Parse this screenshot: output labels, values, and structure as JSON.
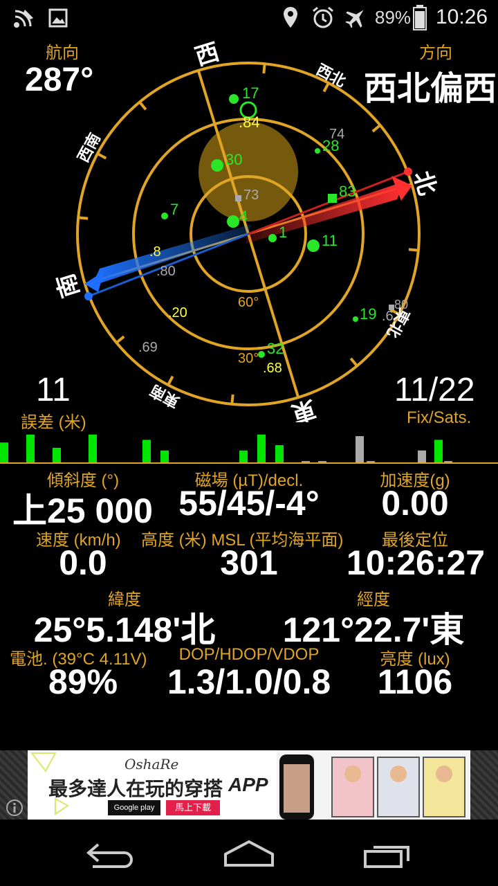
{
  "status": {
    "battery": "89%",
    "time": "10:26",
    "icons": [
      "signal-wifi-icon",
      "image-icon",
      "location-icon",
      "alarm-icon",
      "airplane-icon",
      "battery-icon"
    ]
  },
  "compass": {
    "heading_label": "航向",
    "heading_value": "287°",
    "direction_label": "方向",
    "direction_value": "西北偏西",
    "directions": {
      "west": "西",
      "northwest": "西北",
      "north": "北",
      "northeast": "東北",
      "east": "東",
      "southeast": "東南",
      "south": "南",
      "southwest": "西南"
    },
    "ring_60": "60°",
    "ring_30": "30°",
    "satellites": [
      {
        "id": "17",
        "color": "#29e629"
      },
      {
        "id": "30",
        "color": "#29e629"
      },
      {
        "id": "28",
        "color": "#29e629"
      },
      {
        "id": "7",
        "color": "#29e629"
      },
      {
        "id": "4",
        "color": "#29e629"
      },
      {
        "id": "1",
        "color": "#29e629"
      },
      {
        "id": "11",
        "color": "#29e629"
      },
      {
        "id": "83",
        "color": "#29e629"
      },
      {
        "id": "19",
        "color": "#29e629"
      },
      {
        "id": "32",
        "color": "#29e629"
      }
    ],
    "labels": {
      "l84": ".84",
      "l74": "74",
      "l73": "73",
      "l8": ".8",
      "l80": ".80",
      "l20": ".20",
      "l69": ".69",
      "l68": ".68",
      "l6": ".6",
      "l80b": "80"
    }
  },
  "accuracy": {
    "value": "11",
    "label": "誤差 (米)"
  },
  "fix": {
    "value": "11/22",
    "label": "Fix/Sats."
  },
  "signal_bars": [
    {
      "h": 0.4,
      "c": "#00e600"
    },
    {
      "h": 0.55,
      "c": "#00e600"
    },
    {
      "h": 0.3,
      "c": "#00e600"
    },
    {
      "h": 0.55,
      "c": "#00e600"
    },
    {
      "h": 0.45,
      "c": "#00e600"
    },
    {
      "h": 0.25,
      "c": "#00e600"
    },
    {
      "h": 0.25,
      "c": "#00e600"
    },
    {
      "h": 0.55,
      "c": "#00e600"
    },
    {
      "h": 0.35,
      "c": "#00e600"
    },
    {
      "h": 0.05,
      "c": "#aaaaaa"
    },
    {
      "h": 0.05,
      "c": "#aaaaaa"
    },
    {
      "h": 0.52,
      "c": "#aaaaaa"
    },
    {
      "h": 0.05,
      "c": "#aaaaaa"
    },
    {
      "h": 0.25,
      "c": "#aaaaaa"
    },
    {
      "h": 0.45,
      "c": "#00e600"
    },
    {
      "h": 0.05,
      "c": "#aaaaaa"
    }
  ],
  "readings": {
    "tilt_label": "傾斜度 (°)",
    "tilt_value": "上25 000",
    "mag_label": "磁場 (µT)/decl.",
    "mag_value": "55/45/-4°",
    "accel_label": "加速度(g)",
    "accel_value": "0.00",
    "speed_label": "速度 (km/h)",
    "speed_value": "0.0",
    "alt_label": "高度 (米) MSL (平均海平面)",
    "alt_value": "301",
    "lastfix_label": "最後定位",
    "lastfix_value": "10:26:27",
    "lat_label": "緯度",
    "lat_value": "25°5.148'北",
    "lon_label": "經度",
    "lon_value": "121°22.7'東",
    "batt_label": "電池. (39°C 4.11V)",
    "batt_value": "89%",
    "dop_label": "DOP/HDOP/VDOP",
    "dop_value": "1.3/1.0/0.8",
    "lux_label": "亮度 (lux)",
    "lux_value": "1106"
  },
  "ad": {
    "brand": "OshaRe",
    "headline": "最多達人在玩的穿搭",
    "app": "APP",
    "store": "Google play",
    "cta": "馬上下載"
  },
  "nav": {
    "icons": [
      "back-icon",
      "home-icon",
      "recents-icon"
    ]
  }
}
